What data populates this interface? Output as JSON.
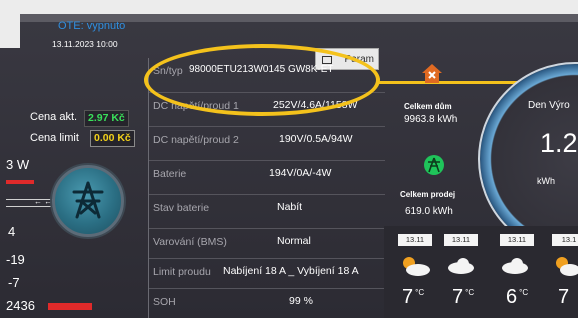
{
  "left": {
    "ote_status": "OTE: vypnuto",
    "ote_date": "13.11.2023 10:00",
    "price_now_label": "Cena akt.",
    "price_now_value": "2.97 Kč",
    "price_limit_label": "Cena limit",
    "price_limit_value": "0.00 Kč",
    "power_label": "3 W",
    "num_4": "4",
    "num_m19": "-19",
    "num_m7": "-7",
    "num_2436": "2436"
  },
  "param_button_label": "Param",
  "table": {
    "rows": [
      {
        "label": "Sn/typ",
        "value": "98000ETU213W0145 GW8K-ET"
      },
      {
        "label": "DC napětí/proud 1",
        "value": "252V/4.6A/1158W"
      },
      {
        "label": "DC napětí/proud 2",
        "value": "190V/0.5A/94W"
      },
      {
        "label": "Baterie",
        "value": "194V/0A/-4W"
      },
      {
        "label": "Stav baterie",
        "value": "Nabít"
      },
      {
        "label": "Varování (BMS)",
        "value": "Normal"
      },
      {
        "label": "Limit proudu",
        "value": "Nabíjení 18 A _ Vybíjení 18 A"
      },
      {
        "label": "SOH",
        "value": "99 %"
      }
    ]
  },
  "right": {
    "house_label": "Celkem dům",
    "house_value": "9963.8 kWh",
    "sold_label": "Celkem prodej",
    "sold_value": "619.0 kWh",
    "gauge_title": "Den Výro",
    "gauge_value": "1.2",
    "gauge_unit": "kWh"
  },
  "weather": {
    "dates": [
      "13.11",
      "13.11",
      "13.11",
      "13.1"
    ],
    "temps": [
      "7",
      "7",
      "6",
      "7"
    ],
    "unit": "°C"
  },
  "colors": {
    "highlight": "#f4c21c",
    "price_now": "#39e05a",
    "price_limit": "#f2d11a",
    "ote": "#2f8fe0"
  }
}
